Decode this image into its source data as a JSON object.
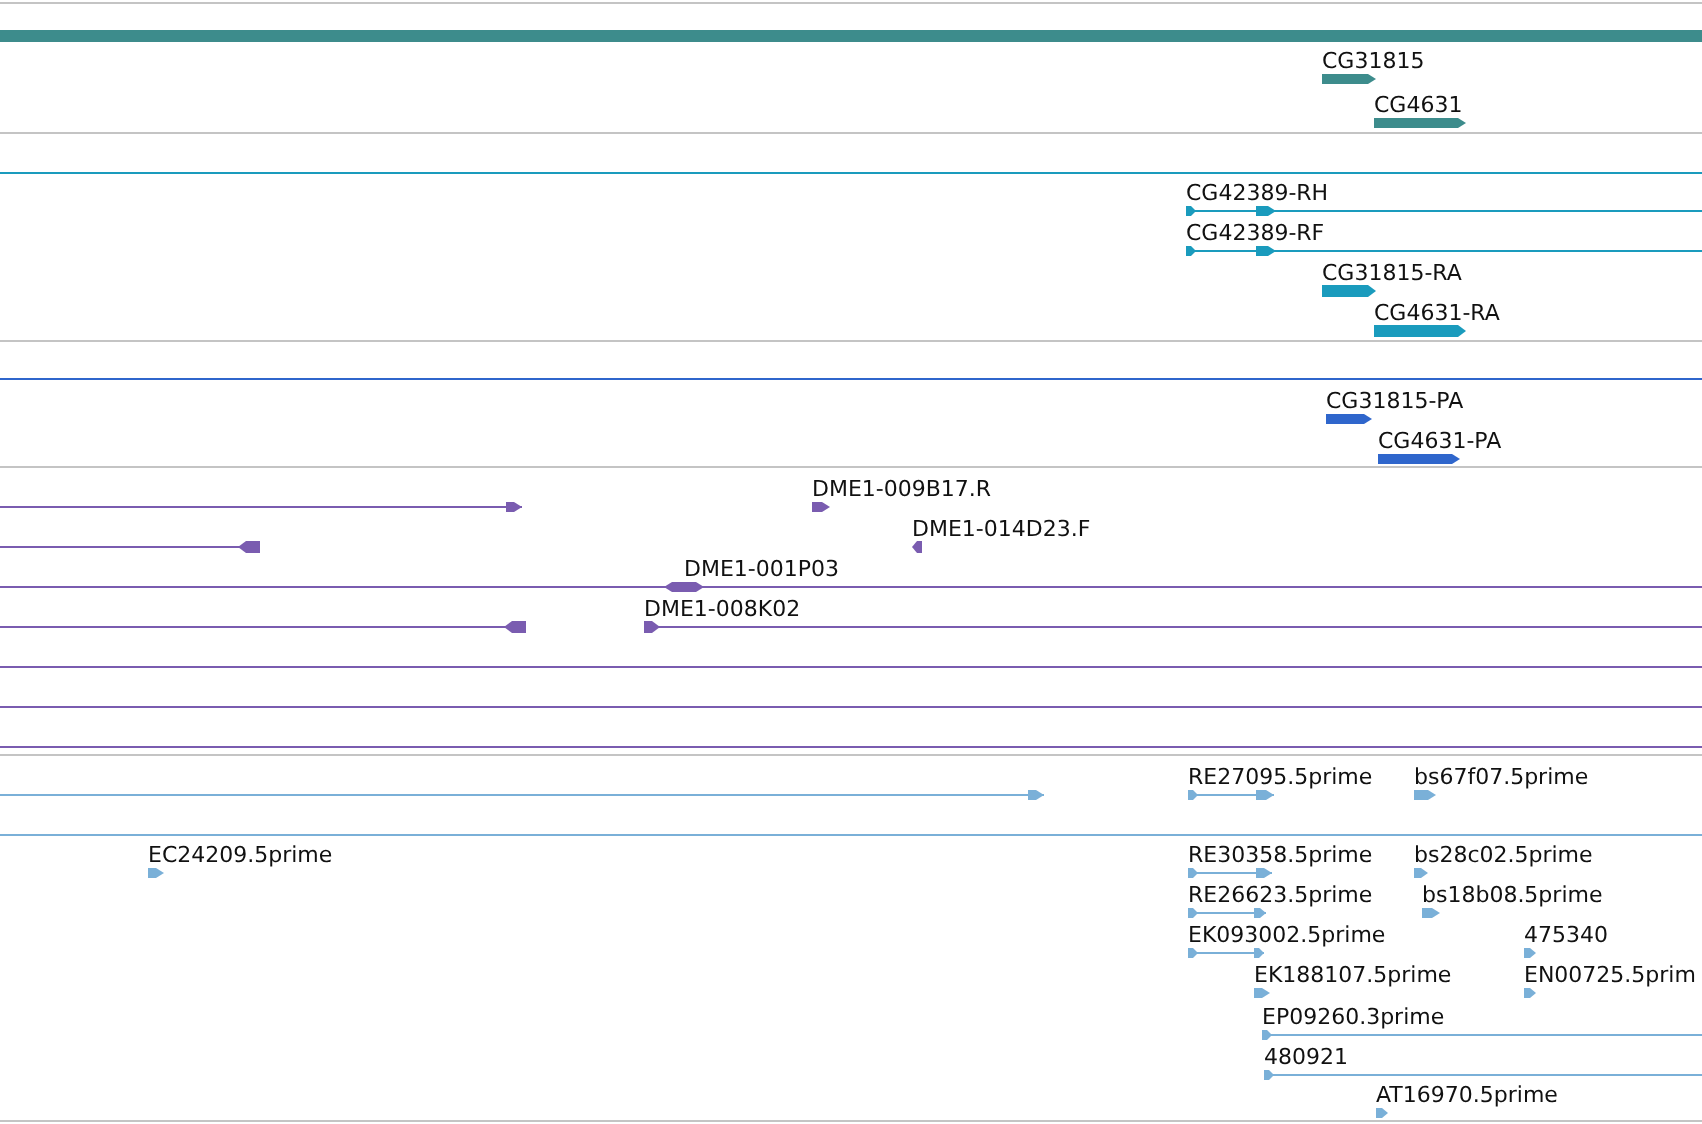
{
  "tracks": [
    {
      "color": "#3d8c8c",
      "labels": [
        "CG31815",
        "CG4631"
      ]
    },
    {
      "color": "#1a9bbd",
      "labels": [
        "CG42389-RH",
        "CG42389-RF",
        "CG31815-RA",
        "CG4631-RA"
      ]
    },
    {
      "color": "#2f66cc",
      "labels": [
        "CG31815-PA",
        "CG4631-PA"
      ]
    },
    {
      "color": "#7a5cb0",
      "labels": [
        "DME1-009B17.R",
        "DME1-014D23.F",
        "DME1-001P03",
        "DME1-008K02"
      ]
    },
    {
      "color": "#7ab0d8",
      "labels": [
        "RE27095.5prime",
        "bs67f07.5prime",
        "EC24209.5prime",
        "RE30358.5prime",
        "bs28c02.5prime",
        "RE26623.5prime",
        "bs18b08.5prime",
        "EK093002.5prime",
        "475340",
        "EK188107.5prime",
        "EN00725.5prim",
        "EP09260.3prime",
        "480921",
        "AT16970.5prime"
      ]
    }
  ]
}
